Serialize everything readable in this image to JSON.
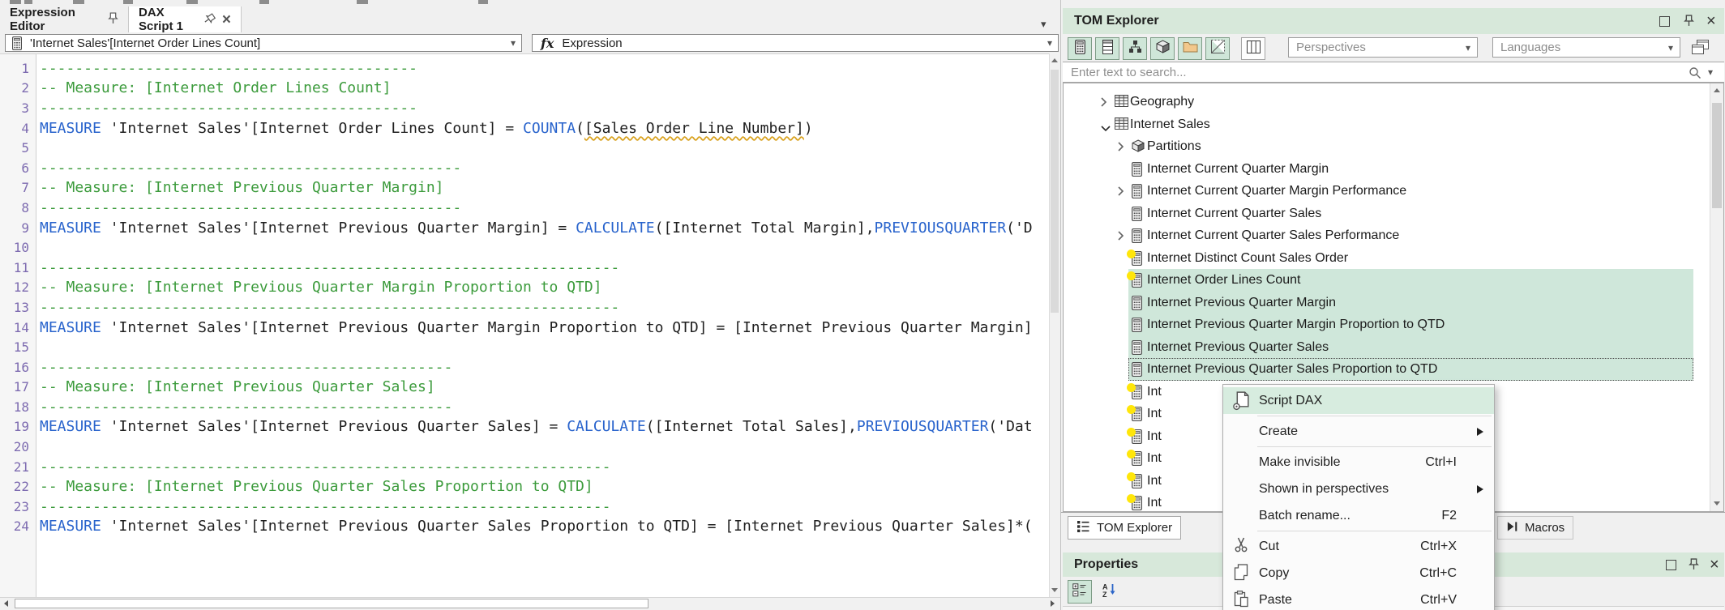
{
  "editor": {
    "tabs": [
      {
        "label": "Expression Editor"
      },
      {
        "label": "DAX Script 1"
      }
    ],
    "measure_dropdown": {
      "value": "'Internet Sales'[Internet Order Lines Count]"
    },
    "expression_dropdown": {
      "fx_glyph": "fx",
      "label": "Expression"
    },
    "code": {
      "lines": [
        {
          "segs": [
            [
              "cm",
              "-------------------------------------------"
            ]
          ]
        },
        {
          "segs": [
            [
              "cm",
              "-- Measure: [Internet Order Lines Count]"
            ]
          ]
        },
        {
          "segs": [
            [
              "cm",
              "-------------------------------------------"
            ]
          ]
        },
        {
          "segs": [
            [
              "kw",
              "MEASURE"
            ],
            [
              "tx",
              " 'Internet Sales'[Internet Order Lines Count] = "
            ],
            [
              "kw",
              "COUNTA"
            ],
            [
              "tx",
              "("
            ],
            [
              "wn",
              "[Sales Order Line Number]"
            ],
            [
              "tx",
              ")"
            ]
          ]
        },
        {
          "segs": []
        },
        {
          "segs": [
            [
              "cm",
              "------------------------------------------------"
            ]
          ]
        },
        {
          "segs": [
            [
              "cm",
              "-- Measure: [Internet Previous Quarter Margin]"
            ]
          ]
        },
        {
          "segs": [
            [
              "cm",
              "------------------------------------------------"
            ]
          ]
        },
        {
          "segs": [
            [
              "kw",
              "MEASURE"
            ],
            [
              "tx",
              " 'Internet Sales'[Internet Previous Quarter Margin] = "
            ],
            [
              "kw",
              "CALCULATE"
            ],
            [
              "tx",
              "([Internet Total Margin],"
            ],
            [
              "kw",
              "PREVIOUSQUARTER"
            ],
            [
              "tx",
              "('D"
            ]
          ]
        },
        {
          "segs": []
        },
        {
          "segs": [
            [
              "cm",
              "------------------------------------------------------------------"
            ]
          ]
        },
        {
          "segs": [
            [
              "cm",
              "-- Measure: [Internet Previous Quarter Margin Proportion to QTD]"
            ]
          ]
        },
        {
          "segs": [
            [
              "cm",
              "------------------------------------------------------------------"
            ]
          ]
        },
        {
          "segs": [
            [
              "kw",
              "MEASURE"
            ],
            [
              "tx",
              " 'Internet Sales'[Internet Previous Quarter Margin Proportion to QTD] = [Internet Previous Quarter Margin]"
            ]
          ]
        },
        {
          "segs": []
        },
        {
          "segs": [
            [
              "cm",
              "-----------------------------------------------"
            ]
          ]
        },
        {
          "segs": [
            [
              "cm",
              "-- Measure: [Internet Previous Quarter Sales]"
            ]
          ]
        },
        {
          "segs": [
            [
              "cm",
              "-----------------------------------------------"
            ]
          ]
        },
        {
          "segs": [
            [
              "kw",
              "MEASURE"
            ],
            [
              "tx",
              " 'Internet Sales'[Internet Previous Quarter Sales] = "
            ],
            [
              "kw",
              "CALCULATE"
            ],
            [
              "tx",
              "([Internet Total Sales],"
            ],
            [
              "kw",
              "PREVIOUSQUARTER"
            ],
            [
              "tx",
              "('Dat"
            ]
          ]
        },
        {
          "segs": []
        },
        {
          "segs": [
            [
              "cm",
              "-----------------------------------------------------------------"
            ]
          ]
        },
        {
          "segs": [
            [
              "cm",
              "-- Measure: [Internet Previous Quarter Sales Proportion to QTD]"
            ]
          ]
        },
        {
          "segs": [
            [
              "cm",
              "-----------------------------------------------------------------"
            ]
          ]
        },
        {
          "segs": [
            [
              "kw",
              "MEASURE"
            ],
            [
              "tx",
              " 'Internet Sales'[Internet Previous Quarter Sales Proportion to QTD] = [Internet Previous Quarter Sales]*("
            ]
          ]
        }
      ]
    }
  },
  "tom_explorer": {
    "title": "TOM Explorer",
    "toolbar": {
      "perspectives_label": "Perspectives",
      "languages_label": "Languages"
    },
    "search_placeholder": "Enter text to search...",
    "tree": {
      "rows": [
        {
          "label": "Geography",
          "icon": "table-icon",
          "level": 0,
          "expander": "collapsed"
        },
        {
          "label": "Internet Sales",
          "icon": "table-icon",
          "level": 0,
          "expander": "expanded"
        },
        {
          "label": "Partitions",
          "icon": "cube-icon",
          "level": 1,
          "expander": "collapsed"
        },
        {
          "label": "Internet Current Quarter Margin",
          "icon": "measure-icon",
          "level": 1
        },
        {
          "label": "Internet Current Quarter Margin Performance",
          "icon": "measure-icon",
          "level": 1,
          "expander": "collapsed"
        },
        {
          "label": "Internet Current Quarter Sales",
          "icon": "measure-icon",
          "level": 1
        },
        {
          "label": "Internet Current Quarter Sales Performance",
          "icon": "measure-icon",
          "level": 1,
          "expander": "collapsed"
        },
        {
          "label": "Internet Distinct Count Sales Order",
          "icon": "measure-icon",
          "level": 1,
          "badge": true
        },
        {
          "label": "Internet Order Lines Count",
          "icon": "measure-icon",
          "level": 1,
          "badge": true,
          "selected": true
        },
        {
          "label": "Internet Previous Quarter Margin",
          "icon": "measure-icon",
          "level": 1,
          "selected": true
        },
        {
          "label": "Internet Previous Quarter Margin Proportion to QTD",
          "icon": "measure-icon",
          "level": 1,
          "selected": true
        },
        {
          "label": "Internet Previous Quarter Sales",
          "icon": "measure-icon",
          "level": 1,
          "selected": true
        },
        {
          "label": "Internet Previous Quarter Sales Proportion to QTD",
          "icon": "measure-icon",
          "level": 1,
          "selected": true,
          "focused": true
        },
        {
          "label": "Int",
          "icon": "measure-icon",
          "level": 1,
          "badge": true
        },
        {
          "label": "Int",
          "icon": "measure-icon",
          "level": 1,
          "badge": true
        },
        {
          "label": "Int",
          "icon": "measure-icon",
          "level": 1,
          "badge": true
        },
        {
          "label": "Int",
          "icon": "measure-icon",
          "level": 1,
          "badge": true
        },
        {
          "label": "Int",
          "icon": "measure-icon",
          "level": 1,
          "badge": true
        },
        {
          "label": "Int",
          "icon": "measure-icon",
          "level": 1,
          "badge": true
        }
      ]
    },
    "bottom_tabs": [
      {
        "label": "TOM Explorer",
        "active": true
      },
      {
        "label": "Macros",
        "active": false
      }
    ]
  },
  "properties": {
    "title": "Properties"
  },
  "context_menu": {
    "items": [
      {
        "label": "Script DAX",
        "icon": "script-dax-icon",
        "hovered": true
      },
      {
        "label": "Create",
        "submenu": true
      },
      {
        "label": "Make invisible",
        "shortcut": "Ctrl+I"
      },
      {
        "label": "Shown in perspectives",
        "submenu": true
      },
      {
        "label": "Batch rename...",
        "shortcut": "F2"
      },
      {
        "label": "Cut",
        "shortcut": "Ctrl+X",
        "icon": "cut-icon"
      },
      {
        "label": "Copy",
        "shortcut": "Ctrl+C",
        "icon": "copy-icon"
      },
      {
        "label": "Paste",
        "shortcut": "Ctrl+V",
        "icon": "paste-icon"
      }
    ],
    "separators_after": [
      0,
      1,
      4
    ]
  },
  "colors": {
    "panel_header": "#d7e8da",
    "selection": "#cfe7da",
    "menu_hover": "#d7ecdf",
    "keyword": "#2863cc",
    "comment": "#3c9b3c",
    "line_number": "#7d6bb0",
    "badge_yellow": "#ffe60a"
  }
}
